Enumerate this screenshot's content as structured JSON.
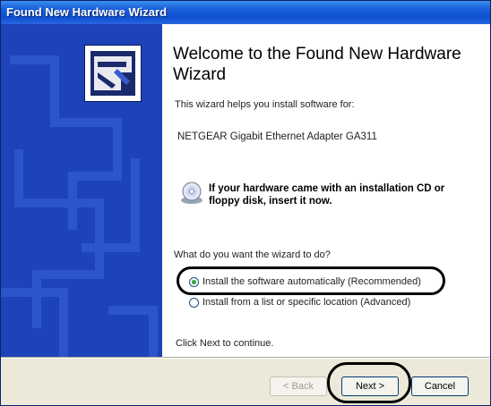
{
  "window": {
    "title": "Found New Hardware Wizard"
  },
  "content": {
    "heading": "Welcome to the Found New Hardware Wizard",
    "intro": "This wizard helps you install software for:",
    "device": "NETGEAR Gigabit Ethernet Adapter GA311",
    "cd_notice": "If your hardware came with an installation CD or floppy disk, insert it now.",
    "question": "What do you want the wizard to do?",
    "options": [
      {
        "label": "Install the software automatically (Recommended)",
        "selected": true
      },
      {
        "label": "Install from a list or specific location (Advanced)",
        "selected": false
      }
    ],
    "continue_hint": "Click Next to continue."
  },
  "buttons": {
    "back": "< Back",
    "next": "Next >",
    "cancel": "Cancel"
  },
  "icons": {
    "wizard": "hardware-wizard-icon",
    "cd": "cd-disk-icon"
  },
  "colors": {
    "titlebar": "#0c4fd0",
    "banner": "#1e43b8",
    "dialog_bg": "#ece9d8"
  }
}
